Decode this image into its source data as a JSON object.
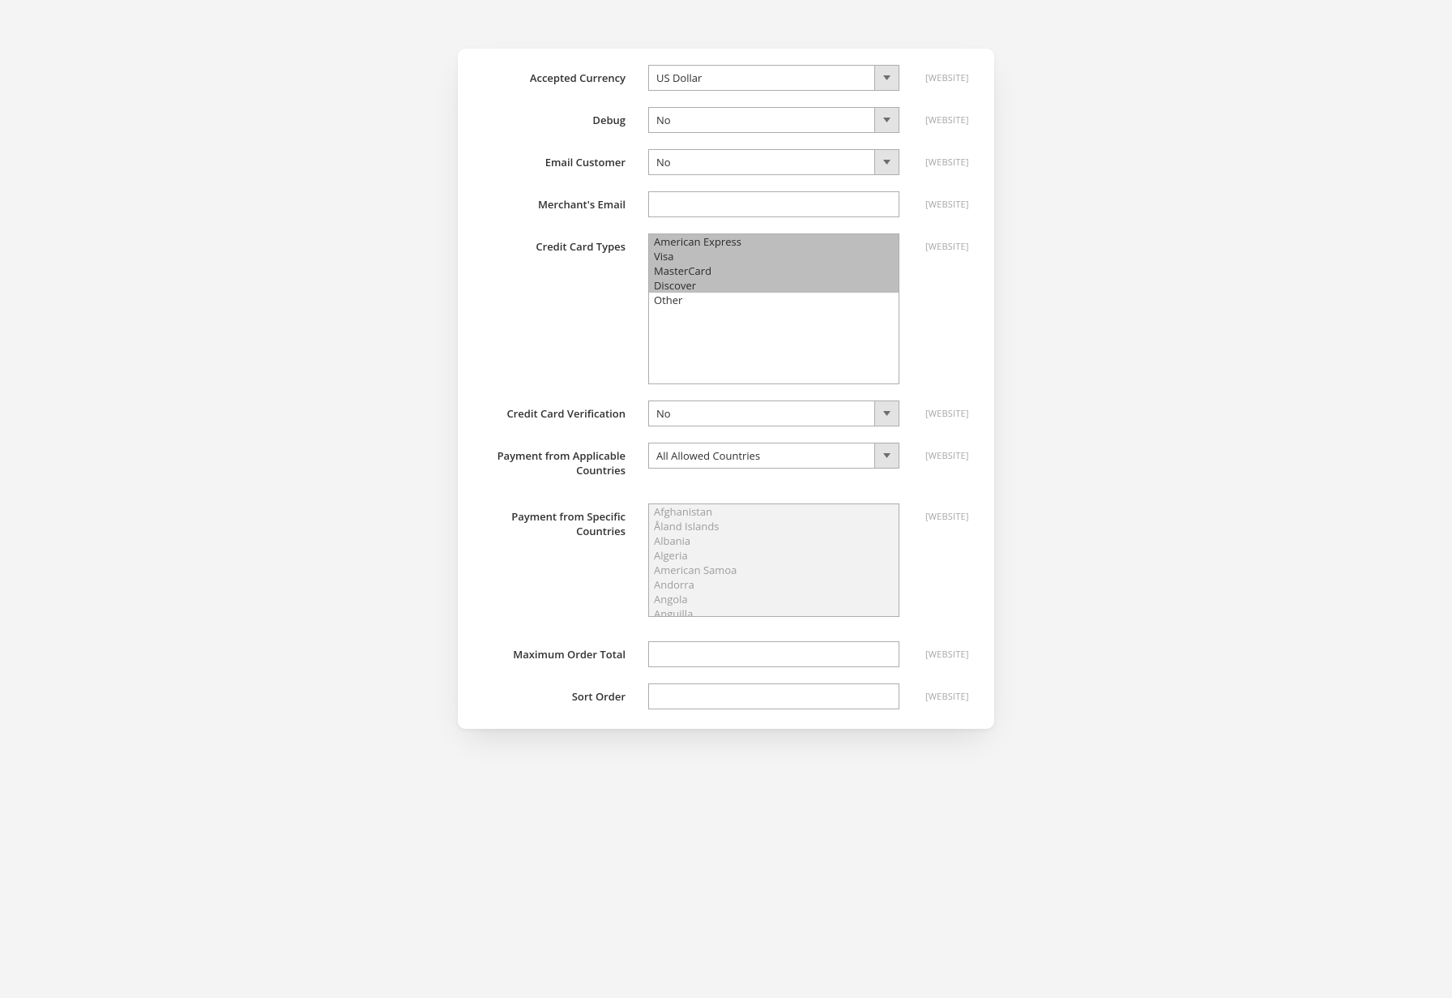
{
  "scope_text": "[WEBSITE]",
  "fields": {
    "accepted_currency": {
      "label": "Accepted Currency",
      "value": "US Dollar"
    },
    "debug": {
      "label": "Debug",
      "value": "No"
    },
    "email_customer": {
      "label": "Email Customer",
      "value": "No"
    },
    "merchant_email": {
      "label": "Merchant's Email",
      "value": ""
    },
    "cc_types": {
      "label": "Credit Card Types",
      "options": [
        {
          "label": "American Express",
          "selected": true
        },
        {
          "label": "Visa",
          "selected": true
        },
        {
          "label": "MasterCard",
          "selected": true
        },
        {
          "label": "Discover",
          "selected": true
        },
        {
          "label": "Other",
          "selected": false
        }
      ]
    },
    "cc_verification": {
      "label": "Credit Card Verification",
      "value": "No"
    },
    "applicable_countries": {
      "label": "Payment from Applicable Countries",
      "value": "All Allowed Countries"
    },
    "specific_countries": {
      "label": "Payment from Specific Countries",
      "disabled": true,
      "options": [
        "Afghanistan",
        "Åland Islands",
        "Albania",
        "Algeria",
        "American Samoa",
        "Andorra",
        "Angola",
        "Anguilla"
      ]
    },
    "max_order_total": {
      "label": "Maximum Order Total",
      "value": ""
    },
    "sort_order": {
      "label": "Sort Order",
      "value": ""
    }
  }
}
